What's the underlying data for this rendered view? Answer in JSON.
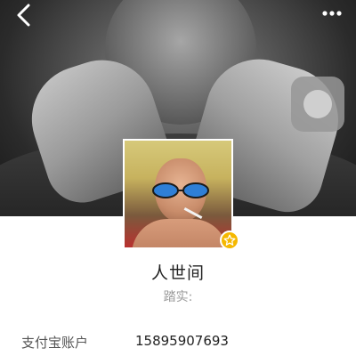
{
  "header": {
    "back_icon": "chevron-left-icon",
    "more_icon": "more-horizontal-icon"
  },
  "profile": {
    "name": "人世间",
    "remark": "踏实:",
    "badge_icon": "star-icon",
    "badge_color": "#f5b800"
  },
  "details": {
    "alipay_label": "支付宝账户",
    "alipay_value": "15895907693"
  },
  "floating": {
    "icon": "assistive-touch-icon"
  }
}
